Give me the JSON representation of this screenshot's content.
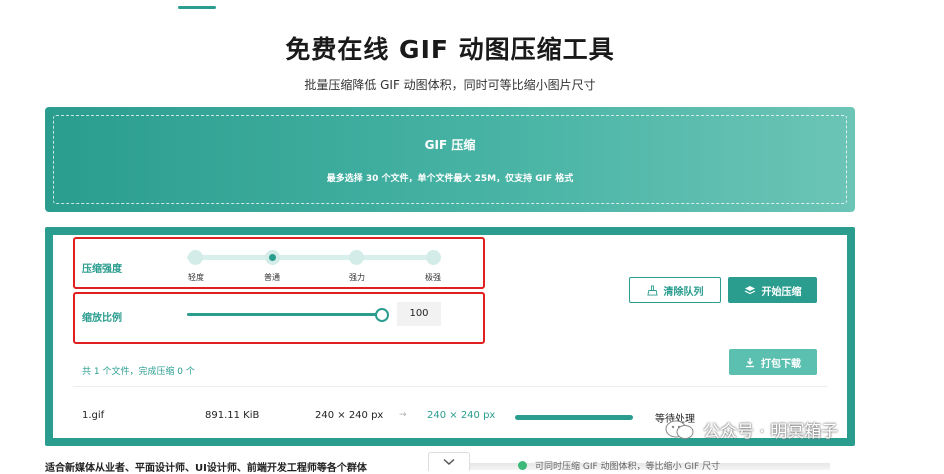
{
  "header": {
    "title": "免费在线 GIF 动图压缩工具",
    "subtitle": "批量压缩降低 GIF 动图体积，同时可等比缩小图片尺寸"
  },
  "upload": {
    "title": "GIF 压缩",
    "note": "最多选择 30 个文件，单个文件最大 25M，仅支持 GIF 格式"
  },
  "settings": {
    "strength_label": "压缩强度",
    "strength_options": [
      "轻度",
      "普通",
      "强力",
      "极强"
    ],
    "strength_selected": "普通",
    "scale_label": "缩放比例",
    "scale_value": "100"
  },
  "actions": {
    "clear_label": "清除队列",
    "start_label": "开始压缩",
    "download_label": "打包下载"
  },
  "summary": "共 1 个文件，完成压缩 0 个",
  "files": [
    {
      "name": "1.gif",
      "size": "891.11 KiB",
      "original_dims": "240 × 240 px",
      "arrow": "→",
      "new_dims": "240 × 240 px",
      "status": "等待处理"
    }
  ],
  "watermark": "公众号 · 明冥箱子",
  "bottom": {
    "left_text": "适合新媒体从业者、平面设计师、UI设计师、前端开发工程师等各个群体",
    "right_text": "可同时压缩 GIF 动图体积，等比缩小 GIF 尺寸"
  },
  "colors": {
    "accent": "#2a9d8f",
    "highlight_box": "#e02020"
  }
}
